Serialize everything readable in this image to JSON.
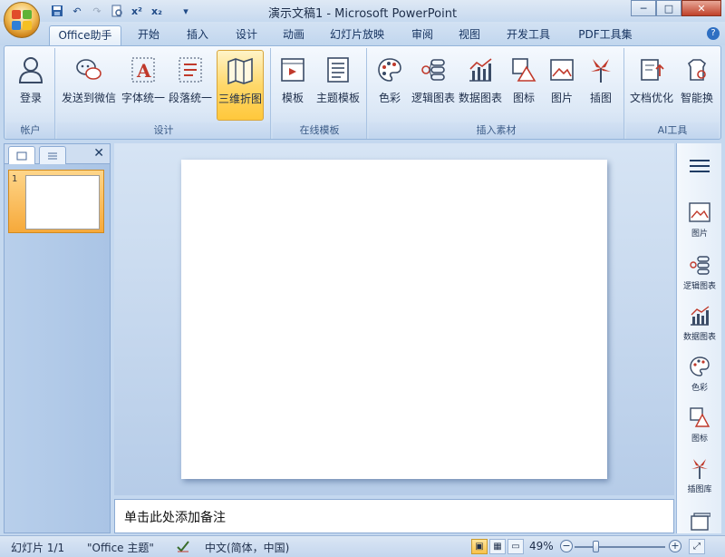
{
  "title_bar": {
    "title": "演示文稿1 - Microsoft PowerPoint"
  },
  "tabs": [
    {
      "label": "Office助手",
      "active": true
    },
    {
      "label": "开始"
    },
    {
      "label": "插入"
    },
    {
      "label": "设计"
    },
    {
      "label": "动画"
    },
    {
      "label": "幻灯片放映"
    },
    {
      "label": "审阅"
    },
    {
      "label": "视图"
    },
    {
      "label": "开发工具"
    },
    {
      "label": "PDF工具集"
    }
  ],
  "ribbon": {
    "groups": {
      "account": {
        "label": "帐户",
        "buttons": [
          {
            "label": "登录",
            "icon": "user-icon"
          }
        ]
      },
      "design": {
        "label": "设计",
        "buttons": [
          {
            "label": "发送到微信",
            "icon": "wechat-icon"
          },
          {
            "label": "字体统一",
            "icon": "font-icon"
          },
          {
            "label": "段落统一",
            "icon": "paragraph-icon"
          },
          {
            "label": "三维折图",
            "icon": "fold-map-icon",
            "highlighted": true
          }
        ]
      },
      "online_templates": {
        "label": "在线模板",
        "buttons": [
          {
            "label": "模板",
            "icon": "template-icon"
          },
          {
            "label": "主题模板",
            "icon": "theme-template-icon"
          }
        ]
      },
      "insert_material": {
        "label": "插入素材",
        "buttons": [
          {
            "label": "色彩",
            "icon": "palette-icon"
          },
          {
            "label": "逻辑图表",
            "icon": "logic-chart-icon"
          },
          {
            "label": "数据图表",
            "icon": "data-chart-icon"
          },
          {
            "label": "图标",
            "icon": "shapes-icon"
          },
          {
            "label": "图片",
            "icon": "picture-icon"
          },
          {
            "label": "插图",
            "icon": "illustration-icon"
          }
        ]
      },
      "ai_tools": {
        "label": "AI工具",
        "buttons": [
          {
            "label": "文档优化",
            "icon": "doc-optimize-icon"
          },
          {
            "label": "智能换",
            "icon": "smart-replace-icon"
          }
        ]
      }
    }
  },
  "slides_panel": {
    "slide_number": "1"
  },
  "notes": {
    "placeholder": "单击此处添加备注"
  },
  "side_panel": {
    "items": [
      {
        "label": "图片",
        "icon": "picture-icon"
      },
      {
        "label": "逻辑图表",
        "icon": "logic-chart-icon"
      },
      {
        "label": "数据图表",
        "icon": "data-chart-icon"
      },
      {
        "label": "色彩",
        "icon": "palette-icon"
      },
      {
        "label": "图标",
        "icon": "shapes-icon"
      },
      {
        "label": "插图库",
        "icon": "illustration-icon"
      }
    ]
  },
  "status_bar": {
    "slide_info": "幻灯片 1/1",
    "theme": "\"Office 主题\"",
    "language": "中文(简体，中国)",
    "zoom": "49%",
    "zoom_level": 0.49
  },
  "colors": {
    "accent": "#f6a93a",
    "ribbon_text": "#1e2e4a",
    "icon_red": "#c0392b"
  }
}
